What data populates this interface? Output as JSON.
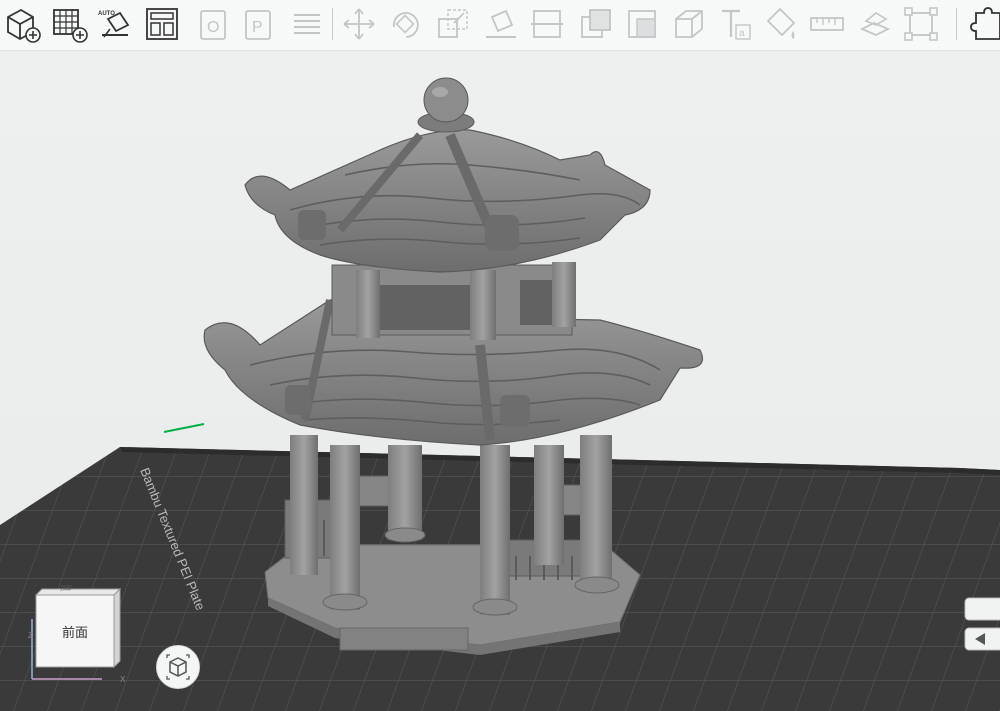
{
  "toolbar": {
    "tools": [
      {
        "name": "add-object",
        "icon": "cube-plus-icon"
      },
      {
        "name": "add-plate",
        "icon": "grid-plus-icon"
      },
      {
        "name": "auto-orient",
        "icon": "auto-orient-icon",
        "label": "AUTO"
      },
      {
        "name": "arrange",
        "icon": "arrange-icon"
      },
      {
        "name": "orient",
        "icon": "orient-icon"
      },
      {
        "name": "plate",
        "icon": "plate-icon"
      },
      {
        "name": "split",
        "icon": "split-icon"
      },
      {
        "name": "move",
        "icon": "move-icon"
      },
      {
        "name": "rotate",
        "icon": "rotate-icon"
      },
      {
        "name": "scale",
        "icon": "scale-icon"
      },
      {
        "name": "lay-on-face",
        "icon": "lay-on-face-icon"
      },
      {
        "name": "cut",
        "icon": "cut-icon"
      },
      {
        "name": "boolean",
        "icon": "boolean-icon"
      },
      {
        "name": "support-paint",
        "icon": "support-paint-icon"
      },
      {
        "name": "seam-paint",
        "icon": "seam-paint-icon"
      },
      {
        "name": "emboss",
        "icon": "emboss-icon"
      },
      {
        "name": "text",
        "icon": "text-icon"
      },
      {
        "name": "color-paint",
        "icon": "color-paint-icon"
      },
      {
        "name": "measure",
        "icon": "measure-icon"
      },
      {
        "name": "assembly",
        "icon": "assembly-icon"
      },
      {
        "name": "fit-view",
        "icon": "fit-view-icon"
      },
      {
        "name": "puzzle",
        "icon": "puzzle-icon"
      }
    ]
  },
  "plate": {
    "label": "Bambu Textured PEI Plate"
  },
  "navcube": {
    "front_label": "前面",
    "top_label": "顶部",
    "axis_x": "X",
    "axis_z": "Z"
  },
  "colors": {
    "model": "#8b8b8b",
    "bed": "#3a3a3a",
    "bed_grid": "#5b5d5d",
    "accent": "#00ae42"
  }
}
